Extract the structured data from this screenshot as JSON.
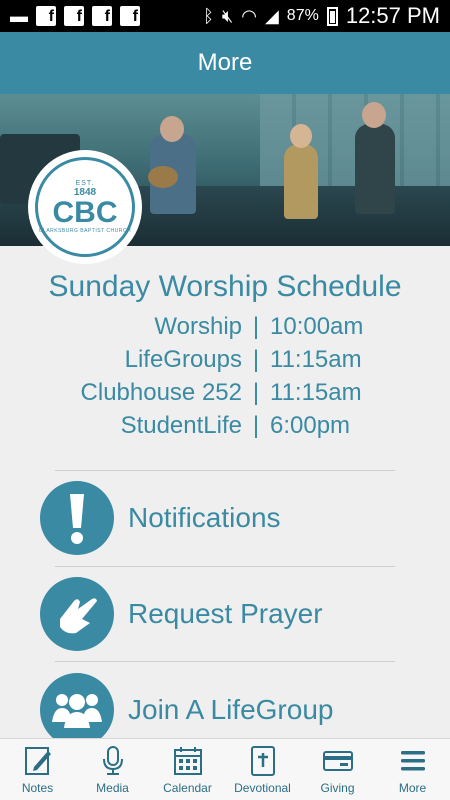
{
  "status_bar": {
    "battery": "87%",
    "time": "12:57 PM"
  },
  "app_bar": {
    "title": "More"
  },
  "logo": {
    "est": "EST.",
    "year": "1848",
    "text": "CBC",
    "subtitle": "CLARKSBURG BAPTIST CHURCH"
  },
  "schedule": {
    "title": "Sunday Worship Schedule",
    "rows": [
      {
        "name": "Worship",
        "sep": "|",
        "time": "10:00am"
      },
      {
        "name": "LifeGroups",
        "sep": "|",
        "time": "11:15am"
      },
      {
        "name": "Clubhouse 252",
        "sep": "|",
        "time": "11:15am"
      },
      {
        "name": "StudentLife",
        "sep": "|",
        "time": "6:00pm"
      }
    ]
  },
  "menu": [
    {
      "label": "Notifications",
      "icon": "exclamation-icon"
    },
    {
      "label": "Request Prayer",
      "icon": "praying-hands-icon"
    },
    {
      "label": "Join A LifeGroup",
      "icon": "group-icon"
    }
  ],
  "bottom_nav": [
    {
      "label": "Notes",
      "icon": "notes-icon"
    },
    {
      "label": "Media",
      "icon": "microphone-icon"
    },
    {
      "label": "Calendar",
      "icon": "calendar-icon"
    },
    {
      "label": "Devotional",
      "icon": "bible-icon"
    },
    {
      "label": "Giving",
      "icon": "card-icon"
    },
    {
      "label": "More",
      "icon": "hamburger-icon"
    }
  ],
  "colors": {
    "accent": "#3a8aa3",
    "nav_text": "#2c6e86",
    "background": "#efefef"
  }
}
